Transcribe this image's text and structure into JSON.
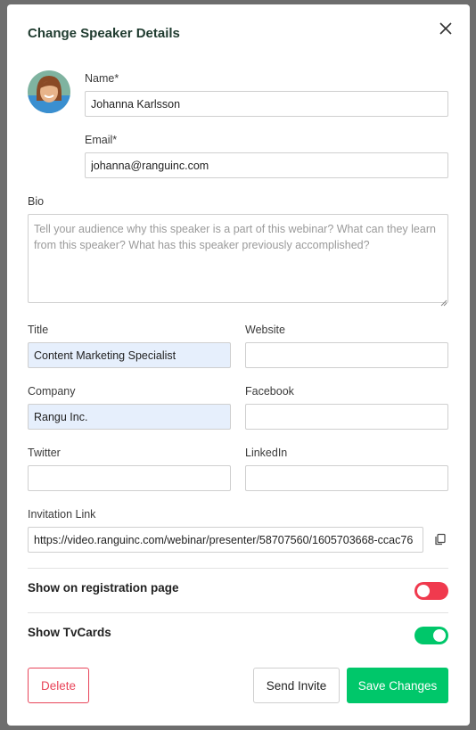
{
  "modal": {
    "title": "Change Speaker Details"
  },
  "form": {
    "name_label": "Name*",
    "name_value": "Johanna Karlsson",
    "email_label": "Email*",
    "email_value": "johanna@ranguinc.com",
    "bio_label": "Bio",
    "bio_placeholder": "Tell your audience why this speaker is a part of this webinar? What can they learn from this speaker? What has this speaker previously accomplished?",
    "title_label": "Title",
    "title_value": "Content Marketing Specialist",
    "website_label": "Website",
    "website_value": "",
    "company_label": "Company",
    "company_value": "Rangu Inc.",
    "facebook_label": "Facebook",
    "facebook_value": "",
    "twitter_label": "Twitter",
    "twitter_value": "",
    "linkedin_label": "LinkedIn",
    "linkedin_value": "",
    "invitation_label": "Invitation Link",
    "invitation_value": "https://video.ranguinc.com/webinar/presenter/58707560/1605703668-ccac76"
  },
  "toggles": {
    "registration_label": "Show on registration page",
    "registration_on": false,
    "tvcards_label": "Show TvCards",
    "tvcards_on": true
  },
  "buttons": {
    "delete": "Delete",
    "send_invite": "Send Invite",
    "save": "Save Changes"
  },
  "colors": {
    "danger": "#e8455a",
    "success": "#00c76a",
    "toggle_off": "#f03a4e",
    "toggle_on": "#00c76a"
  },
  "icons": {
    "close": "close-icon",
    "copy": "copy-icon"
  }
}
